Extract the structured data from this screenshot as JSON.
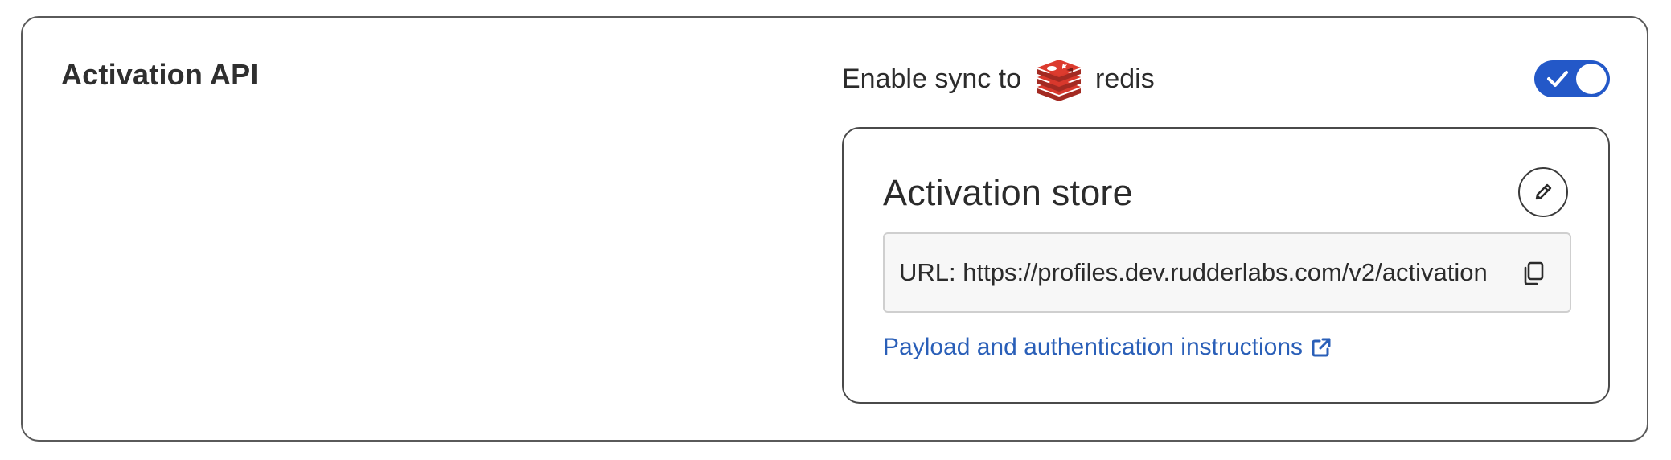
{
  "section": {
    "title": "Activation API"
  },
  "sync": {
    "label": "Enable sync to",
    "destination_name": "redis",
    "destination_icon": "redis-logo-icon",
    "enabled": true,
    "toggle_color": "#2358c8"
  },
  "store": {
    "title": "Activation store",
    "edit_icon": "pencil-icon",
    "url_text": "URL: https://profiles.dev.rudderlabs.com/v2/activation",
    "copy_icon": "copy-icon",
    "link_label": "Payload and authentication instructions",
    "link_icon": "external-link-icon",
    "link_color": "#2a5fb8"
  }
}
